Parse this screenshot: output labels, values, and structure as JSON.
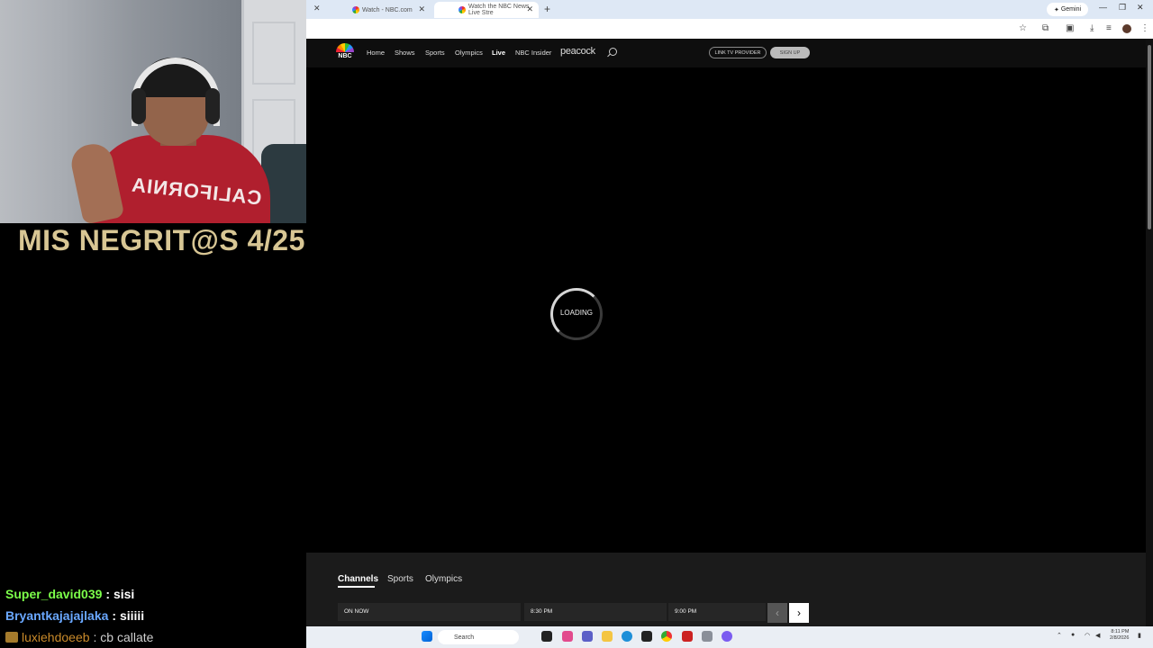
{
  "stream": {
    "title": "MIS NEGRIT@S 4/25",
    "chat": [
      {
        "user": "Super_david039",
        "message": ": sisi"
      },
      {
        "user": "Bryantkajajajlaka",
        "message": ": siiiii"
      },
      {
        "user": "luxiehdoeeb",
        "message": ": cb callate"
      }
    ]
  },
  "browser": {
    "tabs": [
      {
        "label": "Watch - NBC.com"
      },
      {
        "label": "Watch the NBC News Live Stre"
      }
    ],
    "gemini_label": "Gemini"
  },
  "nbc": {
    "logo_text": "NBC",
    "nav": [
      "Home",
      "Shows",
      "Sports",
      "Olympics",
      "Live",
      "NBC Insider"
    ],
    "peacock": "peacock",
    "link_tv_provider": "LINK TV PROVIDER",
    "sign_up": "SIGN UP",
    "loading": "LOADING"
  },
  "schedule": {
    "tabs": [
      "Channels",
      "Sports",
      "Olympics"
    ],
    "times": [
      "ON NOW",
      "8:30 PM",
      "9:00 PM"
    ]
  },
  "taskbar": {
    "search_placeholder": "Search",
    "time": "8:11 PM",
    "date": "2/8/2026"
  }
}
